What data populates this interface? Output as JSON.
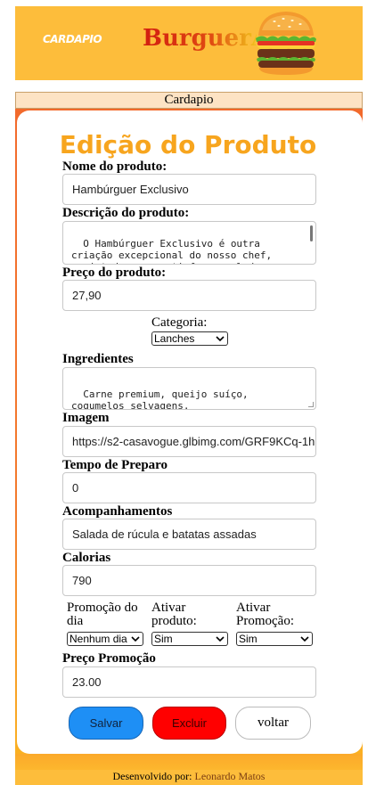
{
  "header": {
    "logo_text": "CARDAPIO",
    "brand": "BurguerA"
  },
  "nav": {
    "cardapio_link": "Cardapio"
  },
  "form": {
    "title": "Edição do Produto",
    "name_label": "Nome do produto:",
    "name_value": "Hambúrguer Exclusivo",
    "description_label": "Descrição do produto:",
    "description_value": "O Hambúrguer Exclusivo é outra criação excepcional do nosso chef, projetado para satisfazer paladares",
    "price_label": "Preço do produto:",
    "price_value": "27,90",
    "category_label": "Categoria:",
    "category_value": "Lanches",
    "ingredients_label": "Ingredientes",
    "ingredients_value": "Carne premium, queijo suíço, cogumelos selvagens.",
    "image_label": "Imagem",
    "image_value": "https://s2-casavogue.glbimg.com/GRF9KCq-1h",
    "prep_time_label": "Tempo de Preparo",
    "prep_time_value": "0",
    "sides_label": "Acompanhamentos",
    "sides_value": "Salada de rúcula e batatas assadas",
    "calories_label": "Calorias",
    "calories_value": "790",
    "promo_day_label": "Promoção do dia",
    "promo_day_value": "Nenhum dia",
    "activate_product_label": "Ativar produto:",
    "activate_product_value": "Sim",
    "activate_promo_label": "Ativar Promoção:",
    "activate_promo_value": "Sim",
    "promo_price_label": "Preço Promoção",
    "promo_price_value": "23.00"
  },
  "buttons": {
    "save": "Salvar",
    "delete": "Excluir",
    "back": "voltar"
  },
  "footer": {
    "prefix": "Desenvolvido por: ",
    "author": "Leonardo Matos"
  },
  "colors": {
    "header_bg": "#fdbd3b",
    "title": "#f7a51e",
    "save_button": "#1e8ff5",
    "delete_button": "#ff0000",
    "content_bg": "#f26a2c"
  }
}
